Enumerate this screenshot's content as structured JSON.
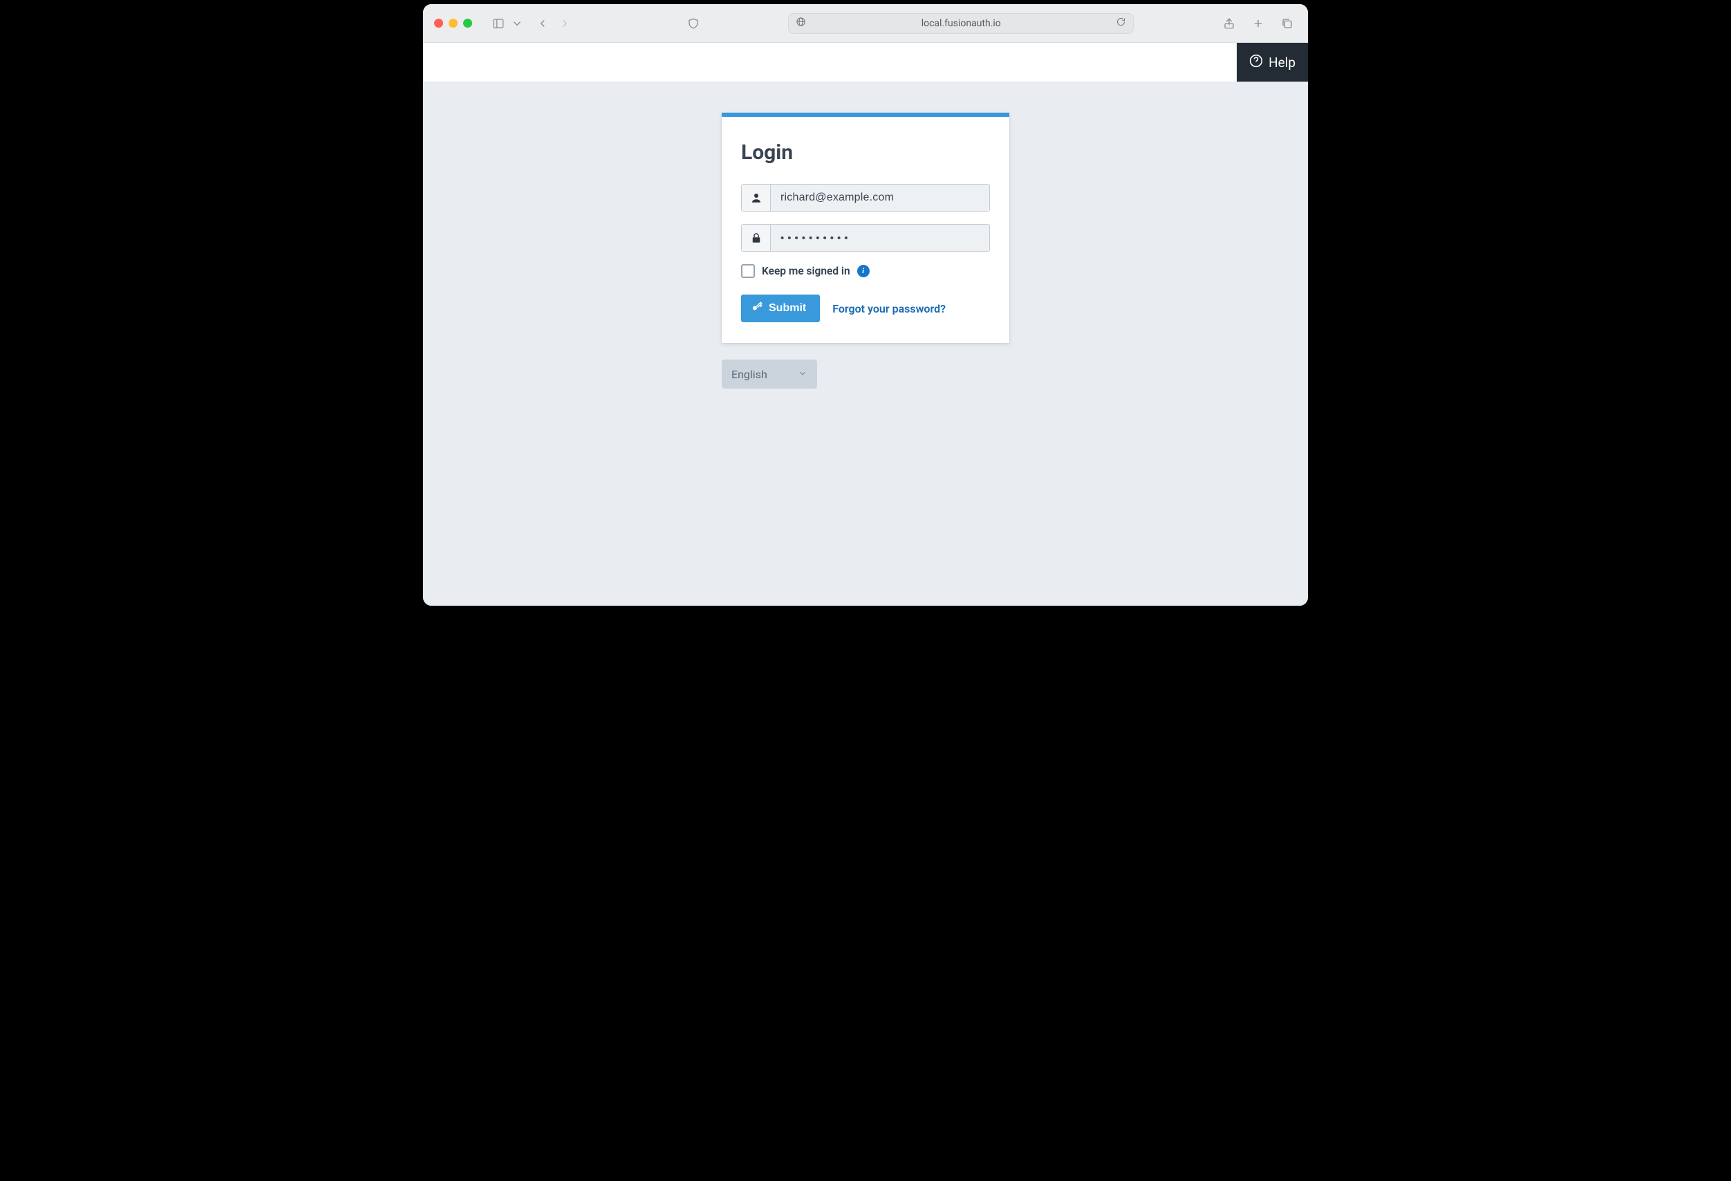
{
  "browser": {
    "url": "local.fusionauth.io"
  },
  "header": {
    "help_label": "Help"
  },
  "login": {
    "title": "Login",
    "email_value": "richard@example.com",
    "password_value": "••••••••••",
    "keep_signed_in_label": "Keep me signed in",
    "submit_label": "Submit",
    "forgot_label": "Forgot your password?"
  },
  "language": {
    "selected": "English"
  }
}
